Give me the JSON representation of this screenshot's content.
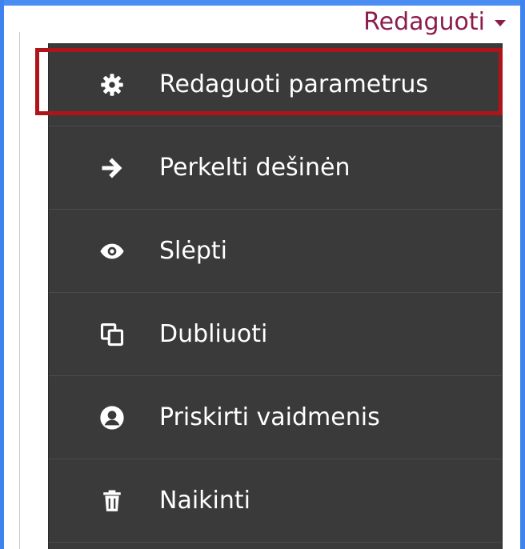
{
  "trigger": {
    "label": "Redaguoti",
    "icon": "caret-down-icon",
    "color": "#8b1d4a"
  },
  "menu": {
    "background": "#3a3a3a",
    "items": [
      {
        "label": "Redaguoti parametrus",
        "icon": "gear-icon",
        "highlighted": true
      },
      {
        "label": "Perkelti dešinėn",
        "icon": "arrow-right-icon"
      },
      {
        "label": "Slėpti",
        "icon": "eye-icon"
      },
      {
        "label": "Dubliuoti",
        "icon": "copy-icon"
      },
      {
        "label": "Priskirti vaidmenis",
        "icon": "user-circle-icon"
      },
      {
        "label": "Naikinti",
        "icon": "trash-icon"
      }
    ]
  },
  "highlight": {
    "color": "#b0141b"
  }
}
